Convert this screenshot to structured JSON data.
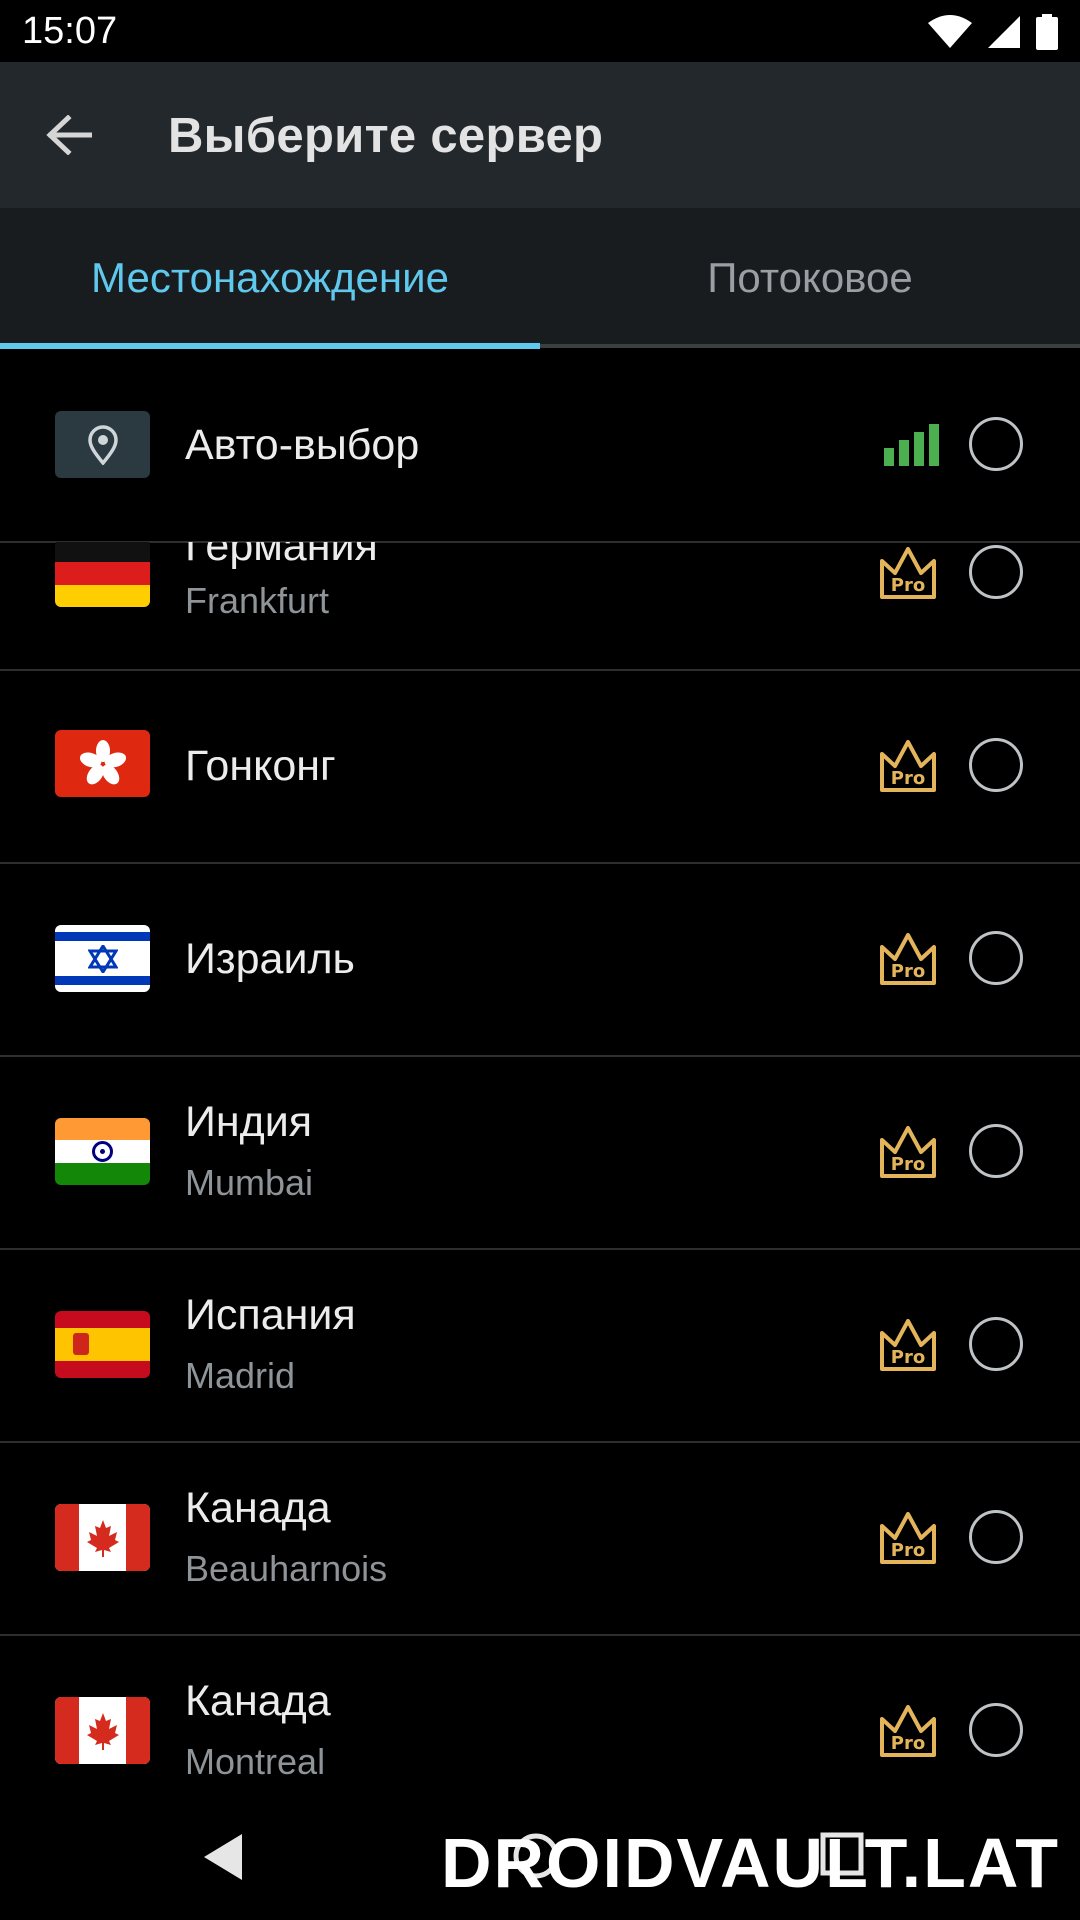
{
  "status_bar": {
    "time": "15:07",
    "icons": [
      "wifi-icon",
      "cell-signal-icon",
      "battery-icon"
    ]
  },
  "app_bar": {
    "title": "Выберите сервер",
    "back_icon": "arrow-back-icon"
  },
  "tabs": [
    {
      "label": "Местонахождение",
      "selected": true
    },
    {
      "label": "Потоковое",
      "selected": false
    }
  ],
  "colors": {
    "accent": "#5fc8ec",
    "pro": "#e3b45a",
    "signal": "#4caf50"
  },
  "servers": [
    {
      "name": "Авто-выбор",
      "city": "",
      "icon": "location-pin-icon",
      "badge": "signal-bars-icon"
    },
    {
      "name": "Германия",
      "city": "Frankfurt",
      "flag": "germany-flag-icon",
      "badge": "Pro"
    },
    {
      "name": "Гонконг",
      "city": "",
      "flag": "hong-kong-flag-icon",
      "badge": "Pro"
    },
    {
      "name": "Израиль",
      "city": "",
      "flag": "israel-flag-icon",
      "badge": "Pro"
    },
    {
      "name": "Индия",
      "city": "Mumbai",
      "flag": "india-flag-icon",
      "badge": "Pro"
    },
    {
      "name": "Испания",
      "city": "Madrid",
      "flag": "spain-flag-icon",
      "badge": "Pro"
    },
    {
      "name": "Канада",
      "city": "Beauharnois",
      "flag": "canada-flag-icon",
      "badge": "Pro"
    },
    {
      "name": "Канада",
      "city": "Montreal",
      "flag": "canada-flag-icon",
      "badge": "Pro"
    }
  ],
  "watermark": "DROIDVAULT.LAT",
  "nav_bar": {
    "icons": [
      "nav-back-icon",
      "nav-home-icon",
      "nav-recents-icon"
    ]
  }
}
